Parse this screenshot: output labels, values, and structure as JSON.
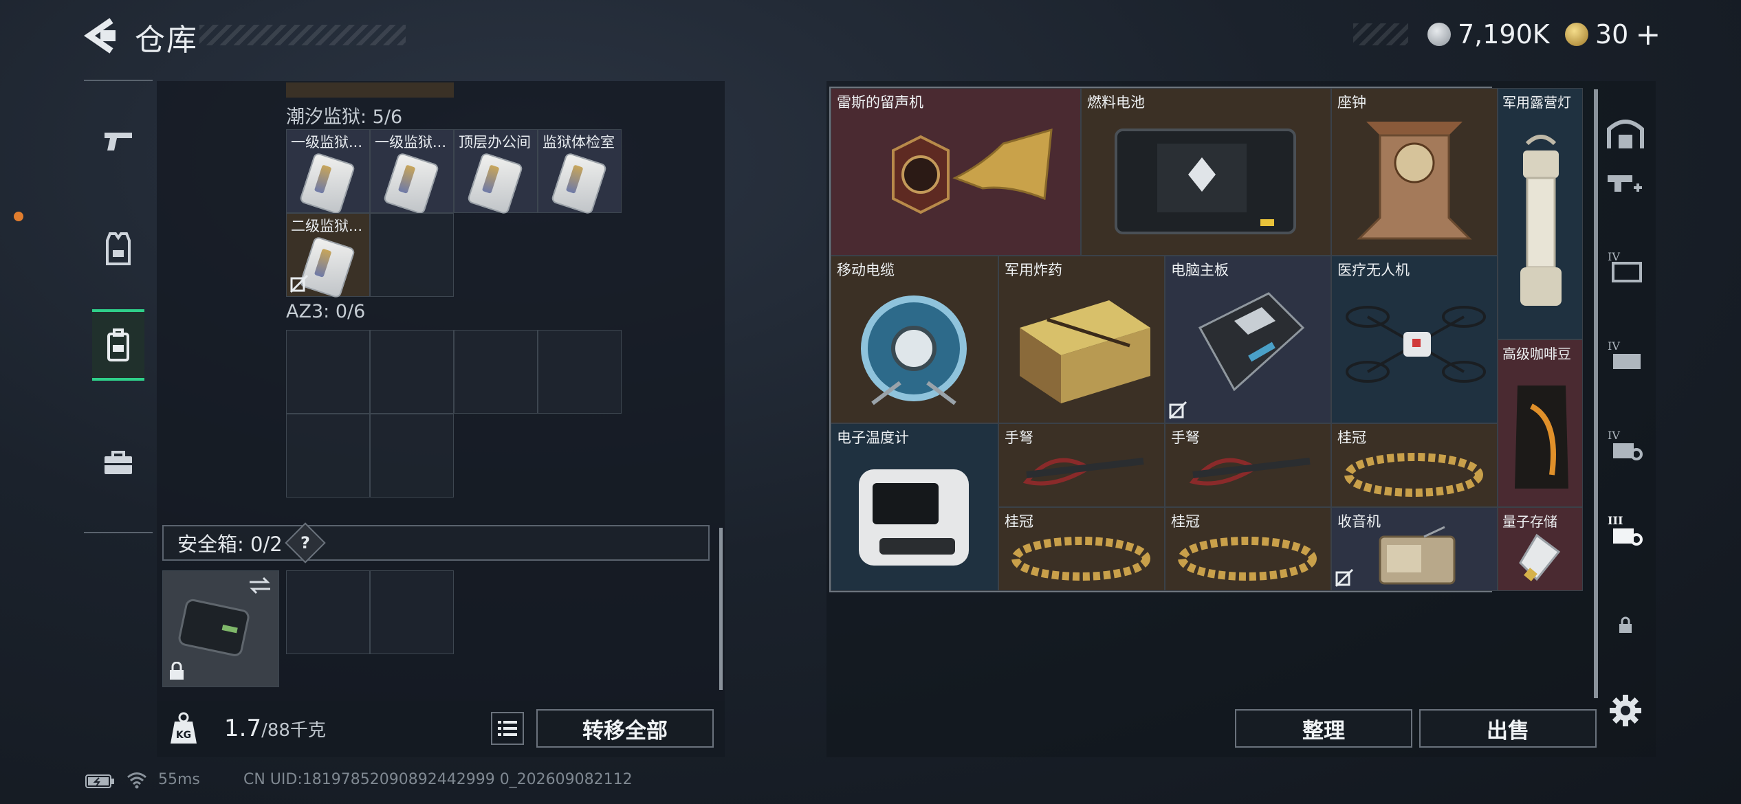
{
  "header": {
    "title": "仓库",
    "currency_main": "7,190K",
    "currency_secondary": "30",
    "plus": "+"
  },
  "left_panel": {
    "zone1_label": "潮汐监狱: 5/6",
    "zone1_items": [
      {
        "name": "一级监狱...",
        "style": "blue"
      },
      {
        "name": "一级监狱...",
        "style": "blue"
      },
      {
        "name": "顶层办公间",
        "style": "blue"
      },
      {
        "name": "监狱体检室",
        "style": "blue"
      },
      {
        "name": "二级监狱...",
        "style": "brown"
      }
    ],
    "zone2_label": "AZ3: 0/6",
    "safebox_label": "安全箱: 0/2",
    "safebox_help": "?",
    "weight_value": "1.7",
    "weight_capacity": "/88千克",
    "transfer_all_label": "转移全部"
  },
  "stash_items": [
    {
      "name": "雷斯的留声机",
      "bg": "#4a2a31"
    },
    {
      "name": "燃料电池",
      "bg": "#3b3025"
    },
    {
      "name": "座钟",
      "bg": "#3b3025"
    },
    {
      "name": "军用露营灯",
      "bg": "#1f3140"
    },
    {
      "name": "移动电缆",
      "bg": "#3b3025"
    },
    {
      "name": "军用炸药",
      "bg": "#3b3025"
    },
    {
      "name": "电脑主板",
      "bg": "#2d3344"
    },
    {
      "name": "医疗无人机",
      "bg": "#1f3140"
    },
    {
      "name": "高级咖啡豆",
      "bg": "#4a2a31"
    },
    {
      "name": "电子温度计",
      "bg": "#1f3140"
    },
    {
      "name": "手弩",
      "bg": "#3b3025"
    },
    {
      "name": "手弩",
      "bg": "#3b3025"
    },
    {
      "name": "桂冠",
      "bg": "#3b3025"
    },
    {
      "name": "桂冠",
      "bg": "#3b3025"
    },
    {
      "name": "桂冠",
      "bg": "#3b3025"
    },
    {
      "name": "收音机",
      "bg": "#2d3344"
    },
    {
      "name": "量子存储",
      "bg": "#4a2a31"
    }
  ],
  "actions": {
    "organize_label": "整理",
    "sell_label": "出售"
  },
  "footer": {
    "ping": "55ms",
    "uid": "CN UID:18197852090892442999 0_202609082112"
  },
  "icons": {
    "back": "chevron-left-icon",
    "weapon": "pistol-icon",
    "armor": "vest-icon",
    "backpack": "backpack-icon",
    "case": "briefcase-icon",
    "settings": "gear-icon"
  }
}
